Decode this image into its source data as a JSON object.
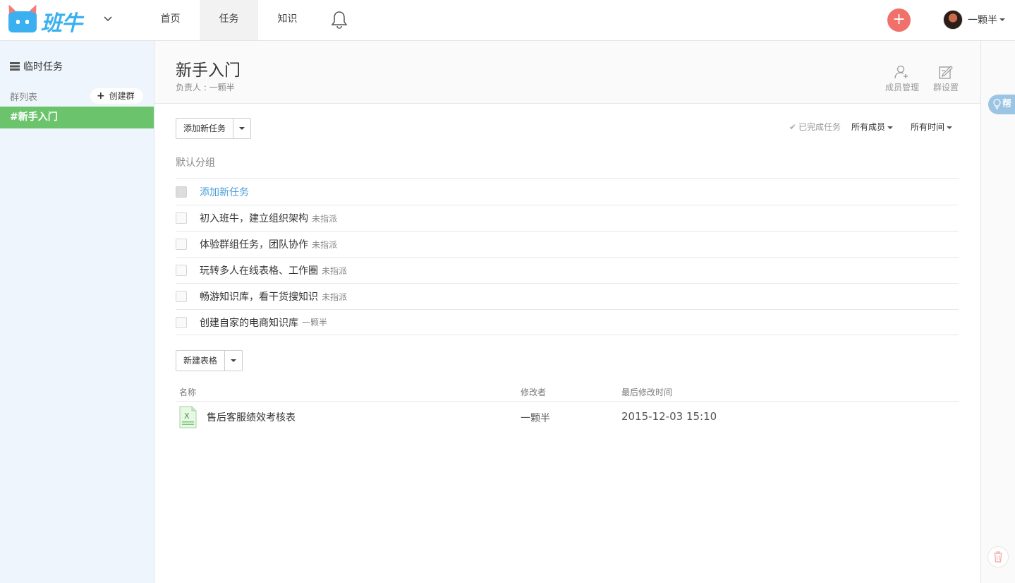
{
  "brand": {
    "name": "班牛"
  },
  "nav": {
    "tabs": [
      {
        "label": "首页"
      },
      {
        "label": "任务"
      },
      {
        "label": "知识"
      }
    ]
  },
  "user": {
    "name": "一颗半"
  },
  "sidebar": {
    "temp_tasks": "临时任务",
    "group_list_title": "群列表",
    "create_group": "创建群",
    "groups": [
      {
        "label": "#新手入门"
      }
    ]
  },
  "header": {
    "title": "新手入门",
    "owner": "负责人 : 一颗半",
    "member_manage": "成员管理",
    "group_settings": "群设置"
  },
  "toolbar": {
    "add_task": "添加新任务",
    "done_tasks": "已完成任务",
    "all_members": "所有成员",
    "all_time": "所有时间"
  },
  "tasks": {
    "section_title": "默认分组",
    "add_label": "添加新任务",
    "items": [
      {
        "title": "初入班牛，建立组织架构",
        "assignee": "未指派"
      },
      {
        "title": "体验群组任务，团队协作",
        "assignee": "未指派"
      },
      {
        "title": "玩转多人在线表格、工作圈",
        "assignee": "未指派"
      },
      {
        "title": "畅游知识库，看干货搜知识",
        "assignee": "未指派"
      },
      {
        "title": "创建自家的电商知识库",
        "assignee": "一颗半"
      }
    ]
  },
  "sheets": {
    "new_label": "新建表格",
    "columns": {
      "name": "名称",
      "modifier": "修改者",
      "modified": "最后修改时间"
    },
    "rows": [
      {
        "name": "售后客服绩效考核表",
        "modifier": "一颗半",
        "modified": "2015-12-03 15:10",
        "icon": "excel-file-icon"
      }
    ]
  },
  "rail": {
    "help": "帮"
  },
  "colors": {
    "brand_blue": "#3ab0f0",
    "accent_red": "#f0706a",
    "active_green": "#6bc46c",
    "link_blue": "#4a9ed8"
  }
}
